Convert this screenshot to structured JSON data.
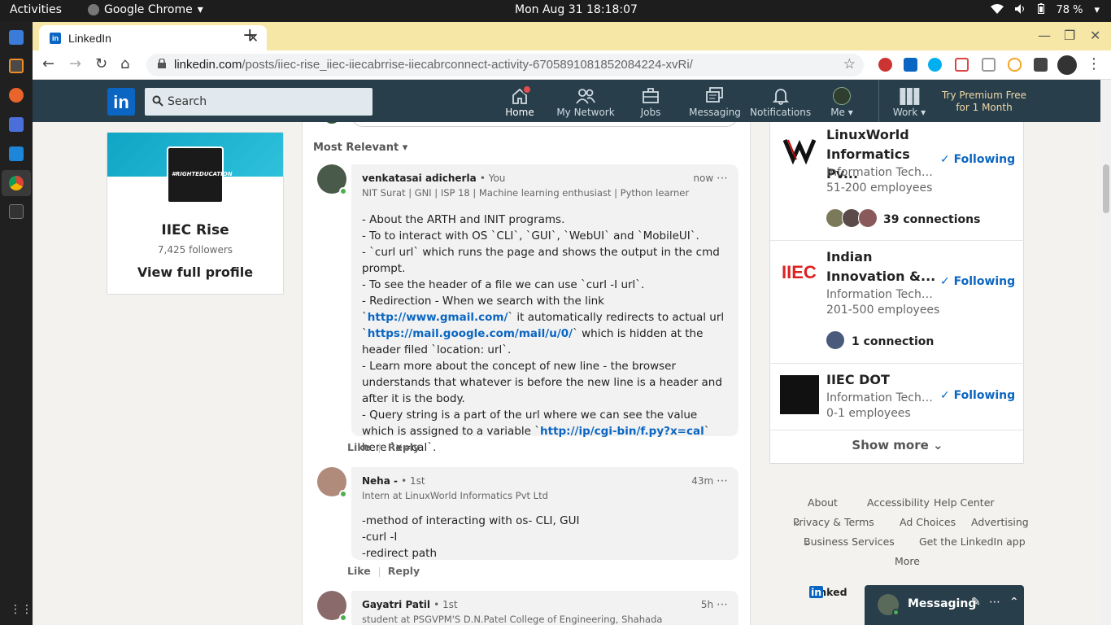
{
  "os": {
    "activities": "Activities",
    "app_name": "Google Chrome",
    "clock": "Mon Aug 31  18:18:07",
    "battery": "78 %"
  },
  "browser": {
    "tab_title": "LinkedIn",
    "url_domain": "linkedin.com",
    "url_path": "/posts/iiec-rise_iiec-iiecabrrise-iiecabrconnect-activity-6705891081852084224-xvRi/"
  },
  "linkedin": {
    "search_placeholder": "Search",
    "nav": {
      "home": "Home",
      "network": "My Network",
      "jobs": "Jobs",
      "messaging": "Messaging",
      "notifications": "Notifications",
      "me": "Me",
      "work": "Work"
    },
    "premium_line1": "Try Premium Free",
    "premium_line2": "for 1 Month"
  },
  "left_card": {
    "logo_text": "#RIGHTEDUCATION",
    "name": "IIEC Rise",
    "followers": "7,425 followers",
    "view_profile": "View full profile"
  },
  "comments": {
    "sort_label": "Most Relevant",
    "items": [
      {
        "name": "venkatasai adicherla",
        "degree": "• You",
        "headline": "NIT Surat | GNI | ISP 18 | Machine learning enthusiast | Python learner",
        "time": "now",
        "lines": {
          "l1": "-  About the ARTH and INIT programs.",
          "l2": "-  To to interact with OS `CLI`, `GUI`, `WebUI` and `MobileUI`.",
          "l3": "-  `curl url` which runs the page and shows the output in the cmd prompt.",
          "l4": "-  To see the header of a file we can use `curl -I url`.",
          "l5a": "-  Redirection - When we search with the link `",
          "link1": "http://www.gmail.com/",
          "l5b": "` it automatically redirects to actual url `",
          "link2": "https://mail.google.com/mail/u/0/",
          "l5c": "`  which is hidden at the header filed `location: url`.",
          "l6": "-  Learn more about the concept of new line - the browser understands that whatever is before the new line is a header and after it is the body.",
          "l7a": "-  Query string is a part of the url where we can see the value which is assigned to a variable `",
          "link3": "http://ip/cgi-bin/f.py?x=cal",
          "l7b": "` here `x=cal`."
        },
        "like": "Like",
        "reply": "Reply"
      },
      {
        "name": "Neha -",
        "degree": "• 1st",
        "headline": "Intern at LinuxWorld Informatics Pvt Ltd",
        "time": "43m",
        "l1": "-method of interacting with os- CLI, GUI",
        "l2": "-curl -I",
        "l3": "-redirect path",
        "like": "Like",
        "reply": "Reply"
      },
      {
        "name": "Gayatri Patil",
        "degree": "• 1st",
        "headline": "student at PSGVPM'S D.N.Patel College of Engineering, Shahada",
        "time": "5h"
      }
    ]
  },
  "companies": [
    {
      "name": "LinuxWorld Informatics Pv...",
      "industry": "Information Techn...",
      "size": "51-200 employees",
      "follow": "Following",
      "connections": "39 connections"
    },
    {
      "name": "Indian Innovation &...",
      "industry": "Information Techn...",
      "size": "201-500 employees",
      "follow": "Following",
      "connections": "1 connection"
    },
    {
      "name": "IIEC DOT",
      "industry": "Information Techn...",
      "size": "0-1 employees",
      "follow": "Following"
    }
  ],
  "show_more": "Show more",
  "footer": {
    "about": "About",
    "accessibility": "Accessibility",
    "help": "Help Center",
    "privacy": "Privacy & Terms",
    "ad_choices": "Ad Choices",
    "advertising": "Advertising",
    "business": "Business Services",
    "app": "Get the LinkedIn app",
    "more": "More",
    "brand": "Linked"
  },
  "messaging_bar": {
    "label": "Messaging"
  }
}
